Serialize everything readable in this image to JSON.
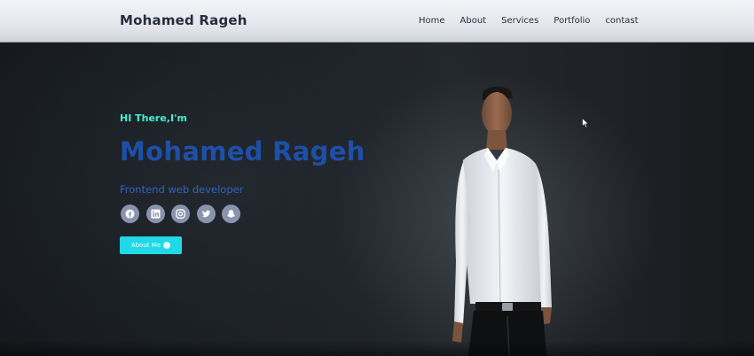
{
  "header": {
    "brand": "Mohamed Rageh",
    "nav": [
      "Home",
      "About",
      "Services",
      "Portfolio",
      "contast"
    ]
  },
  "hero": {
    "greeting": "HI There,I'm",
    "name": "Mohamed Rageh",
    "role": "Frontend web developer",
    "socials": [
      "facebook-icon",
      "linkedin-icon",
      "instagram-icon",
      "twitter-icon",
      "snapchat-icon"
    ],
    "cta_label": "About Me"
  },
  "colors": {
    "accent_cyan": "#20d8e6",
    "greeting": "#3ef0d4",
    "name_blue": "#1e4fa8",
    "role_blue": "#2f62c4",
    "social_bg": "#8a93ad"
  }
}
